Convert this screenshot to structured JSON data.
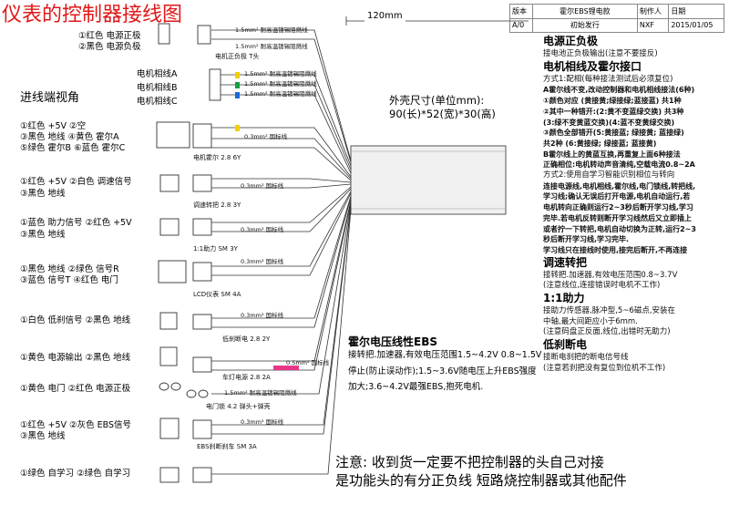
{
  "title": "仪表的控制器接线图",
  "title_block": {
    "version_label": "版本",
    "model": "霍尔EBS锂电款",
    "maker_label": "制作人",
    "date_label": "日期",
    "version": "A/0",
    "release": "初始发行",
    "maker": "NXF",
    "date": "2015/01/05"
  },
  "dimension_label": "120mm",
  "housing": {
    "line1": "外壳尺寸(单位mm):",
    "line2": "90(长)*52(宽)*30(高)"
  },
  "inlet_view": "进线端视角",
  "connectors": [
    {
      "lines": [
        "①红色 电源正极",
        "②黑色 电源负极"
      ],
      "wire_labels": [
        "1.5mm² 耐高温镀锡阻燃线",
        "1.5mm² 耐高温镀锡阻燃线"
      ],
      "connector_label": "电机正负极 T头"
    },
    {
      "lines": [
        "电机相线A",
        "电机相线B",
        "电机相线C"
      ],
      "wire_labels": [
        "1.5mm² 耐高温镀锡阻燃线",
        "1.5mm² 耐高温镀锡阻燃线",
        "1.5mm² 耐高温镀锡阻燃线"
      ],
      "connector_label": ""
    },
    {
      "lines": [
        "①红色 +5V  ②空",
        "③黑色 地线  ④黄色 霍尔A",
        "⑤绿色 霍尔B  ⑥蓝色 霍尔C"
      ],
      "wire_labels": [
        "0.3mm² 国标线"
      ],
      "connector_label": "电机霍尔 2.8 6Y"
    },
    {
      "lines": [
        "①红色 +5V  ②白色 调速信号",
        "③黑色 地线"
      ],
      "wire_labels": [
        "0.3mm² 国标线"
      ],
      "connector_label": "调速转把 2.8 3Y"
    },
    {
      "lines": [
        "①蓝色 助力信号  ②红色 +5V",
        "③黑色 地线"
      ],
      "wire_labels": [
        "0.3mm² 国标线"
      ],
      "connector_label": "1:1助力 SM 3Y"
    },
    {
      "lines": [
        "①黑色 地线   ②绿色 信号R",
        "③蓝色 信号T  ④红色 电门"
      ],
      "wire_labels": [
        "0.3mm² 国标线"
      ],
      "connector_label": "LCD仪表 SM 4A"
    },
    {
      "lines": [
        "①白色 低刹信号  ②黑色 地线"
      ],
      "wire_labels": [
        "0.3mm² 国标线"
      ],
      "connector_label": "低刹断电 2.8 2Y"
    },
    {
      "lines": [
        "①黄色 电源输出  ②黑色 地线"
      ],
      "wire_labels": [
        "0.5mm² 国标线"
      ],
      "connector_label": "车灯电源 2.8 2A"
    },
    {
      "lines": [
        "①黄色 电门  ②红色 电源正极"
      ],
      "wire_labels": [
        "1.5mm² 耐高温镀锡阻燃线"
      ],
      "connector_label": "电门锁 4.2 弹头+弹壳"
    },
    {
      "lines": [
        "①红色 +5V  ②灰色 EBS信号",
        "③黑色 地线"
      ],
      "wire_labels": [
        "0.3mm² 国标线"
      ],
      "connector_label": "EBS刹断刹车 SM 3A"
    },
    {
      "lines": [
        "①绿色 自学习  ②绿色 自学习"
      ],
      "wire_labels": [],
      "connector_label": ""
    }
  ],
  "right_panel": [
    {
      "text": "电源正负极",
      "style": "h"
    },
    {
      "text": "接电池正负极输出(注意不要接反)",
      "style": "n"
    },
    {
      "text": "电机相线及霍尔接口",
      "style": "h"
    },
    {
      "text": "方式1:配相(每种接法测试后必须复位)",
      "style": "n"
    },
    {
      "text": "A霍尔线不变,改动控制器和电机相线接法(6种)",
      "style": "b"
    },
    {
      "text": "①颜色对应 (黄接黄;绿接绿;蓝接蓝) 共1种",
      "style": "b"
    },
    {
      "text": "②其中一种错开:(2:黄不变蓝绿交换) 共3种",
      "style": "b"
    },
    {
      "text": "(3:绿不变黄蓝交换)(4:蓝不变黄绿交换)",
      "style": "b"
    },
    {
      "text": "③颜色全部错开(5:黄接蓝; 绿接黄; 蓝接绿)",
      "style": "b"
    },
    {
      "text": "共2种     (6:黄接绿; 绿接蓝; 蓝接黄)",
      "style": "b"
    },
    {
      "text": "B霍尔线上的黄蓝互换,再重复上面6种接法",
      "style": "b"
    },
    {
      "text": "正确相位:电机转动声音清纯,空载电流0.8~2A",
      "style": "b"
    },
    {
      "text": "方式2:使用自学习智能识别相位与转向",
      "style": "n"
    },
    {
      "text": "连接电源线,电机相线,霍尔线,电门锁线,转把线,",
      "style": "b"
    },
    {
      "text": "学习线;确认无误后打开电源,电机自动运行,若",
      "style": "b"
    },
    {
      "text": "电机转向正确则运行2~3秒后断开学习线,学习",
      "style": "b"
    },
    {
      "text": "完毕.若电机反转则断开学习线然后又立即插上",
      "style": "b"
    },
    {
      "text": "或者拧一下转把,电机自动切换为正转,运行2~3",
      "style": "b"
    },
    {
      "text": "秒后断开学习线,学习完毕.",
      "style": "b"
    },
    {
      "text": "学习线只在接线时使用,接完后断开,不再连接",
      "style": "b"
    },
    {
      "text": "调速转把",
      "style": "h"
    },
    {
      "text": "接转把.加速器,有效电压范围0.8~3.7V",
      "style": "n"
    },
    {
      "text": "(注意线位,连接错误时电机不工作)",
      "style": "n"
    },
    {
      "text": "1:1助力",
      "style": "h"
    },
    {
      "text": "接助力传感器,脉冲型,5~6磁点,安装在",
      "style": "n"
    },
    {
      "text": "中轴,最大间距应小于6mm.",
      "style": "n"
    },
    {
      "text": "(注意码盘正反面,线位,出错时无助力)",
      "style": "n"
    },
    {
      "text": "低刹断电",
      "style": "h"
    },
    {
      "text": "接断电刹把的断电信号线",
      "style": "n"
    },
    {
      "text": "(注意若刹把没有复位到位机不工作)",
      "style": "n"
    }
  ],
  "ebs": {
    "heading": "霍尔电压线性EBS",
    "body": "接转把.加速器,有效电压范围1.5~4.2V 0.8~1.5V停止(防止误动作);1.5~3.6V随电压上升EBS强度加大;3.6~4.2V最强EBS,抱死电机."
  },
  "notice": {
    "line1": "注意: 收到货一定要不把控制器的头自己对接",
    "line2": "是功能头的有分正负线 短路烧控制器或其他配件"
  },
  "colors": {
    "title": "#e01818",
    "phase_a": "#f0d000",
    "phase_b": "#10a040",
    "phase_c": "#1a6ad8",
    "ebs_wire": "#e8368a"
  }
}
